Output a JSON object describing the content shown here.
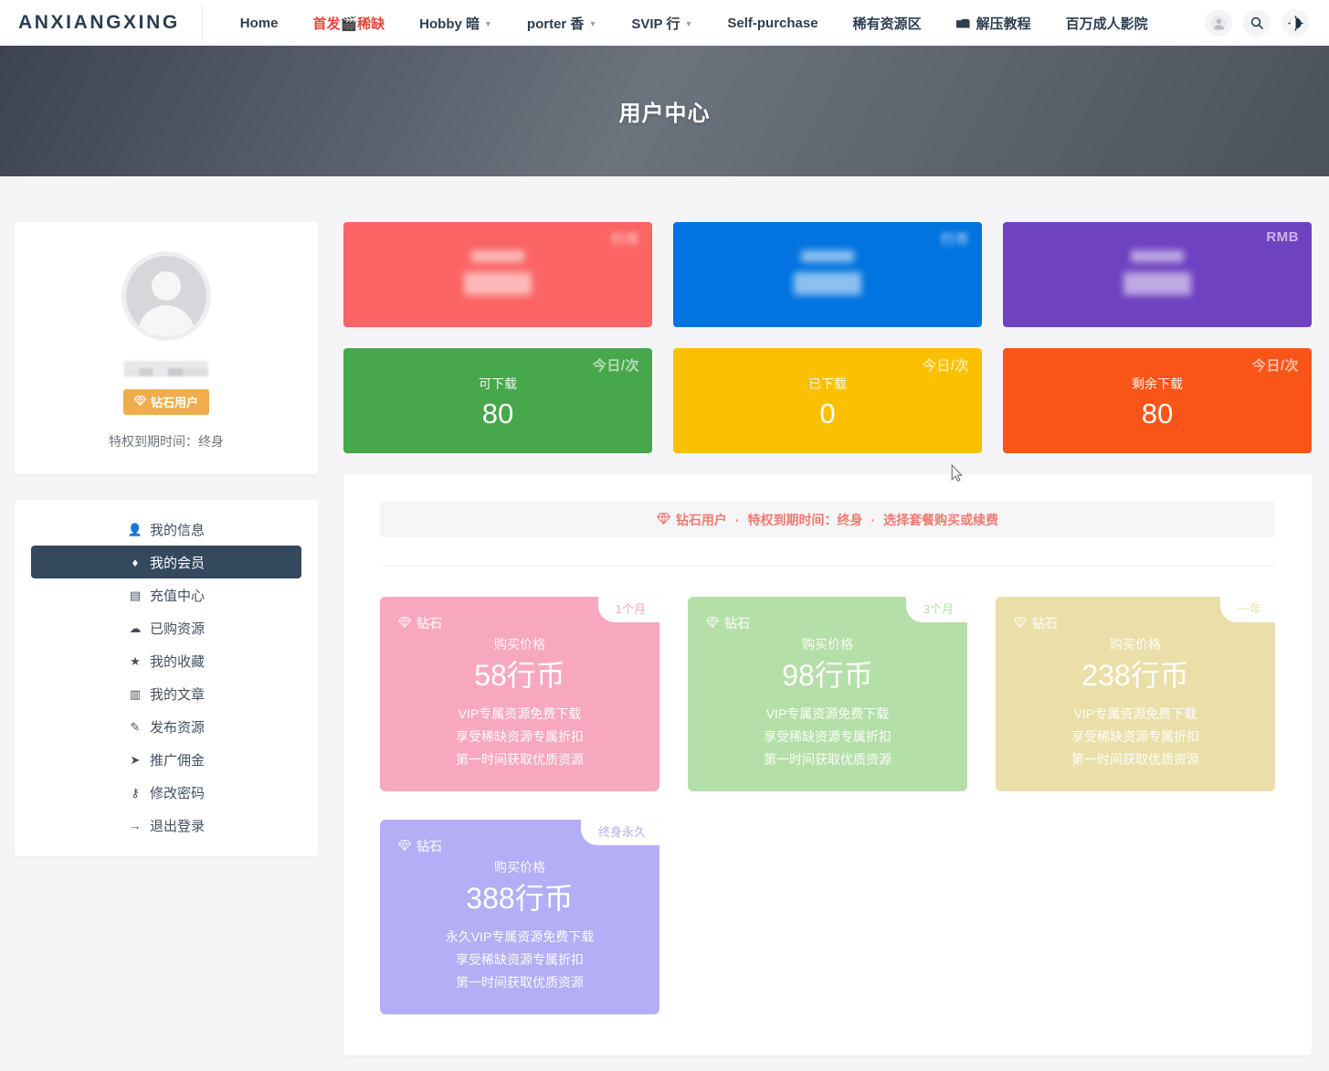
{
  "navbar": {
    "brand": "ANXIANGXING",
    "items": [
      {
        "label": "Home",
        "accent": false,
        "caret": false,
        "folder": false
      },
      {
        "label": "首发🎬稀缺",
        "accent": true,
        "caret": false,
        "folder": false
      },
      {
        "label": "Hobby 暗",
        "accent": false,
        "caret": true,
        "folder": false
      },
      {
        "label": "porter 香",
        "accent": false,
        "caret": true,
        "folder": false
      },
      {
        "label": "SVIP 行",
        "accent": false,
        "caret": true,
        "folder": false
      },
      {
        "label": "Self-purchase",
        "accent": false,
        "caret": false,
        "folder": false
      },
      {
        "label": "稀有资源区",
        "accent": false,
        "caret": false,
        "folder": false
      },
      {
        "label": "解压教程",
        "accent": false,
        "caret": false,
        "folder": true
      },
      {
        "label": "百万成人影院",
        "accent": false,
        "caret": false,
        "folder": false
      }
    ],
    "icons": {
      "account": "account-icon",
      "search": "search-icon",
      "theme": "dark-mode-icon"
    }
  },
  "hero": {
    "title": "用户中心"
  },
  "profile": {
    "avatar_alt": "default-user-avatar",
    "username_masked": "",
    "badge": "钻石用户",
    "badge_icon": "diamond-icon",
    "expire": "特权到期时间：终身"
  },
  "menu": {
    "items": [
      {
        "label": "我的信息",
        "icon": "user-icon",
        "glyph": "👤",
        "active": false
      },
      {
        "label": "我的会员",
        "icon": "diamond-icon",
        "glyph": "♦",
        "active": true
      },
      {
        "label": "充值中心",
        "icon": "credit-card-icon",
        "glyph": "▤",
        "active": false
      },
      {
        "label": "已购资源",
        "icon": "cloud-download-icon",
        "glyph": "☁",
        "active": false
      },
      {
        "label": "我的收藏",
        "icon": "star-icon",
        "glyph": "★",
        "active": false
      },
      {
        "label": "我的文章",
        "icon": "document-icon",
        "glyph": "▥",
        "active": false
      },
      {
        "label": "发布资源",
        "icon": "pencil-icon",
        "glyph": "✎",
        "active": false
      },
      {
        "label": "推广佣金",
        "icon": "paper-plane-icon",
        "glyph": "➤",
        "active": false
      },
      {
        "label": "修改密码",
        "icon": "key-icon",
        "glyph": "⚷",
        "active": false
      },
      {
        "label": "退出登录",
        "icon": "logout-icon",
        "glyph": "→",
        "active": false
      }
    ]
  },
  "stats": {
    "cards": [
      {
        "name": "coin-balance",
        "label": "",
        "value": "",
        "tag": "行币",
        "color": "#fa6464",
        "blurred": true,
        "tag_blurred": true
      },
      {
        "name": "coin-consumed",
        "label": "",
        "value": "",
        "tag": "行币",
        "color": "#0274e0",
        "blurred": true,
        "tag_blurred": true
      },
      {
        "name": "rmb-balance",
        "label": "",
        "value": "",
        "tag": "RMB",
        "color": "#6f42c1",
        "blurred": true,
        "tag_blurred": false
      },
      {
        "name": "downloads-available",
        "label": "可下载",
        "value": "80",
        "tag": "今日/次",
        "color": "#46a84b",
        "blurred": false,
        "tag_blurred": false
      },
      {
        "name": "downloads-used",
        "label": "已下载",
        "value": "0",
        "tag": "今日/次",
        "color": "#fbc000",
        "blurred": false,
        "tag_blurred": false
      },
      {
        "name": "downloads-remaining",
        "label": "剩余下载",
        "value": "80",
        "tag": "今日/次",
        "color": "#fa5518",
        "blurred": false,
        "tag_blurred": false
      }
    ]
  },
  "membership": {
    "notice_icon": "diamond-icon",
    "notice_parts": [
      "钻石用户",
      "特权到期时间：终身",
      "选择套餐购买或续费"
    ],
    "notice_sep": "·",
    "plans": [
      {
        "brand": "钻石",
        "ribbon": "1个月",
        "sub": "购买价格",
        "price": "58行币",
        "features": [
          "VIP专属资源免费下载",
          "享受稀缺资源专属折扣",
          "第一时间获取优质资源"
        ],
        "color": "#f7a8bf"
      },
      {
        "brand": "钻石",
        "ribbon": "3个月",
        "sub": "购买价格",
        "price": "98行币",
        "features": [
          "VIP专属资源免费下载",
          "享受稀缺资源专属折扣",
          "第一时间获取优质资源"
        ],
        "color": "#b5dfa8"
      },
      {
        "brand": "钻石",
        "ribbon": "一年",
        "sub": "购买价格",
        "price": "238行币",
        "features": [
          "VIP专属资源免费下载",
          "享受稀缺资源专属折扣",
          "第一时间获取优质资源"
        ],
        "color": "#eadfa8"
      },
      {
        "brand": "钻石",
        "ribbon": "终身永久",
        "sub": "购买价格",
        "price": "388行币",
        "features": [
          "永久VIP专属资源免费下载",
          "享受稀缺资源专属折扣",
          "第一时间获取优质资源"
        ],
        "color": "#b3aef5"
      }
    ]
  },
  "colors": {
    "brand_dark": "#2c3e50",
    "accent_red": "#e8453c",
    "active_menu": "#34495e",
    "badge_orange": "#f0ad4e",
    "notice_pink": "#f07a73"
  }
}
